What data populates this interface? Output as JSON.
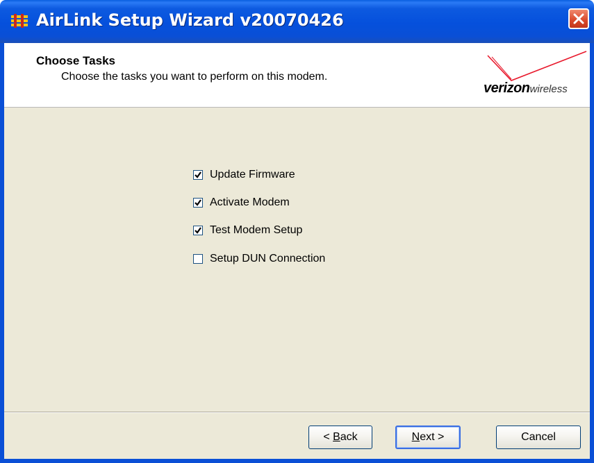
{
  "window": {
    "title": "AirLink Setup Wizard v20070426",
    "app_icon": "airlink-app-icon",
    "close_icon": "close-icon"
  },
  "header": {
    "title": "Choose Tasks",
    "subtitle": "Choose the tasks you want to perform on this modem.",
    "logo": {
      "brand": "verizon",
      "suffix": "wireless",
      "color": "#e8192c"
    }
  },
  "tasks": [
    {
      "label": "Update Firmware",
      "checked": true
    },
    {
      "label": "Activate Modem",
      "checked": true
    },
    {
      "label": "Test Modem Setup",
      "checked": true
    },
    {
      "label": "Setup DUN Connection",
      "checked": false
    }
  ],
  "buttons": {
    "back": {
      "accel": "B",
      "rest": "ack",
      "prefix": "< "
    },
    "next": {
      "accel": "N",
      "rest": "ext",
      "suffix": " >"
    },
    "cancel": {
      "label": "Cancel"
    }
  },
  "colors": {
    "titlebar": "#0550dc",
    "panel": "#ece9d8",
    "checkbox_border": "#1c5180",
    "default_button_border": "#3a6ee3"
  }
}
